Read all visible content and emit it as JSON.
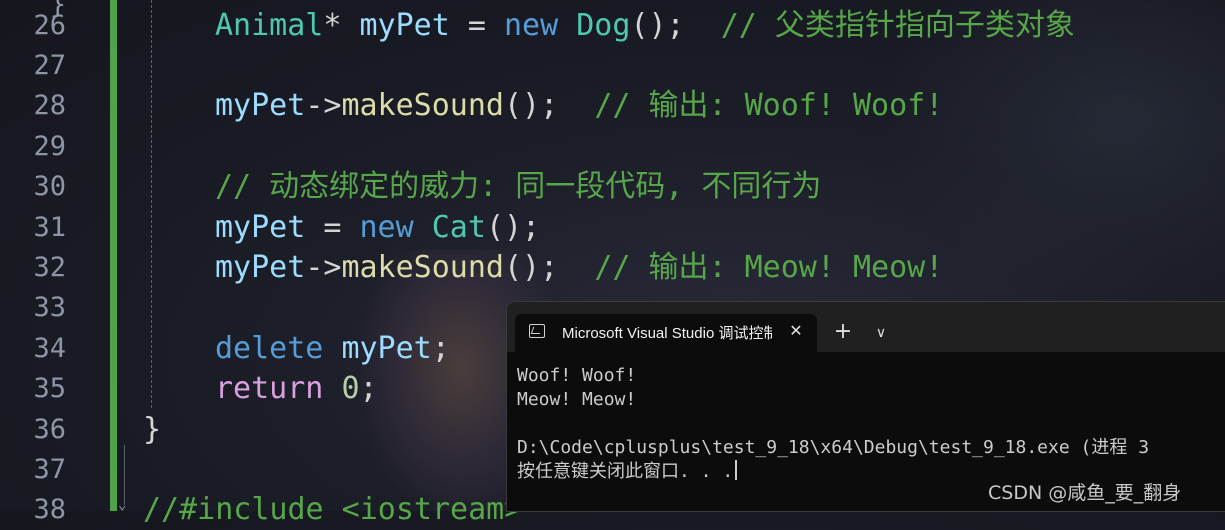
{
  "editor": {
    "line_numbers": [
      "26",
      "27",
      "28",
      "29",
      "30",
      "31",
      "32",
      "33",
      "34",
      "35",
      "36",
      "37",
      "38"
    ],
    "top_partial": "}",
    "code": {
      "l26": {
        "type": "Animal",
        "ptr": "*",
        "var": "myPet",
        "eq": " = ",
        "kw_new": "new",
        "cls": "Dog",
        "call": "();",
        "comment": "// 父类指针指向子类对象"
      },
      "l28": {
        "var": "myPet",
        "arrow": "->",
        "fn": "makeSound",
        "call": "();",
        "comment": "// 输出: Woof! Woof!"
      },
      "l30": {
        "comment": "// 动态绑定的威力: 同一段代码, 不同行为"
      },
      "l31": {
        "var": "myPet",
        "eq": " = ",
        "kw_new": "new",
        "cls": "Cat",
        "call": "();"
      },
      "l32": {
        "var": "myPet",
        "arrow": "->",
        "fn": "makeSound",
        "call": "();",
        "comment": "// 输出: Meow! Meow!"
      },
      "l34": {
        "kw": "delete",
        "var": "myPet",
        "semi": ";"
      },
      "l35": {
        "kw": "return",
        "num": "0",
        "semi": ";"
      },
      "l36": {
        "brace": "}"
      },
      "l38": {
        "text": "//#include <iostream>"
      }
    }
  },
  "terminal": {
    "tab_title": "Microsoft Visual Studio 调试控制台",
    "close_glyph": "✕",
    "new_tab_glyph": "+",
    "dropdown_glyph": "∨",
    "output": [
      "Woof! Woof!",
      "Meow! Meow!",
      "",
      "D:\\Code\\cplusplus\\test_9_18\\x64\\Debug\\test_9_18.exe (进程 3",
      "按任意键关闭此窗口. . ."
    ]
  },
  "watermark": "CSDN @咸鱼_要_翻身",
  "colors": {
    "keyword": "#569cd6",
    "type": "#4ec9b0",
    "variable": "#9cdcfe",
    "function": "#dcdcaa",
    "comment": "#57a64a",
    "number": "#b5cea8",
    "control": "#d8a0df",
    "change_bar": "#4ea34a"
  }
}
